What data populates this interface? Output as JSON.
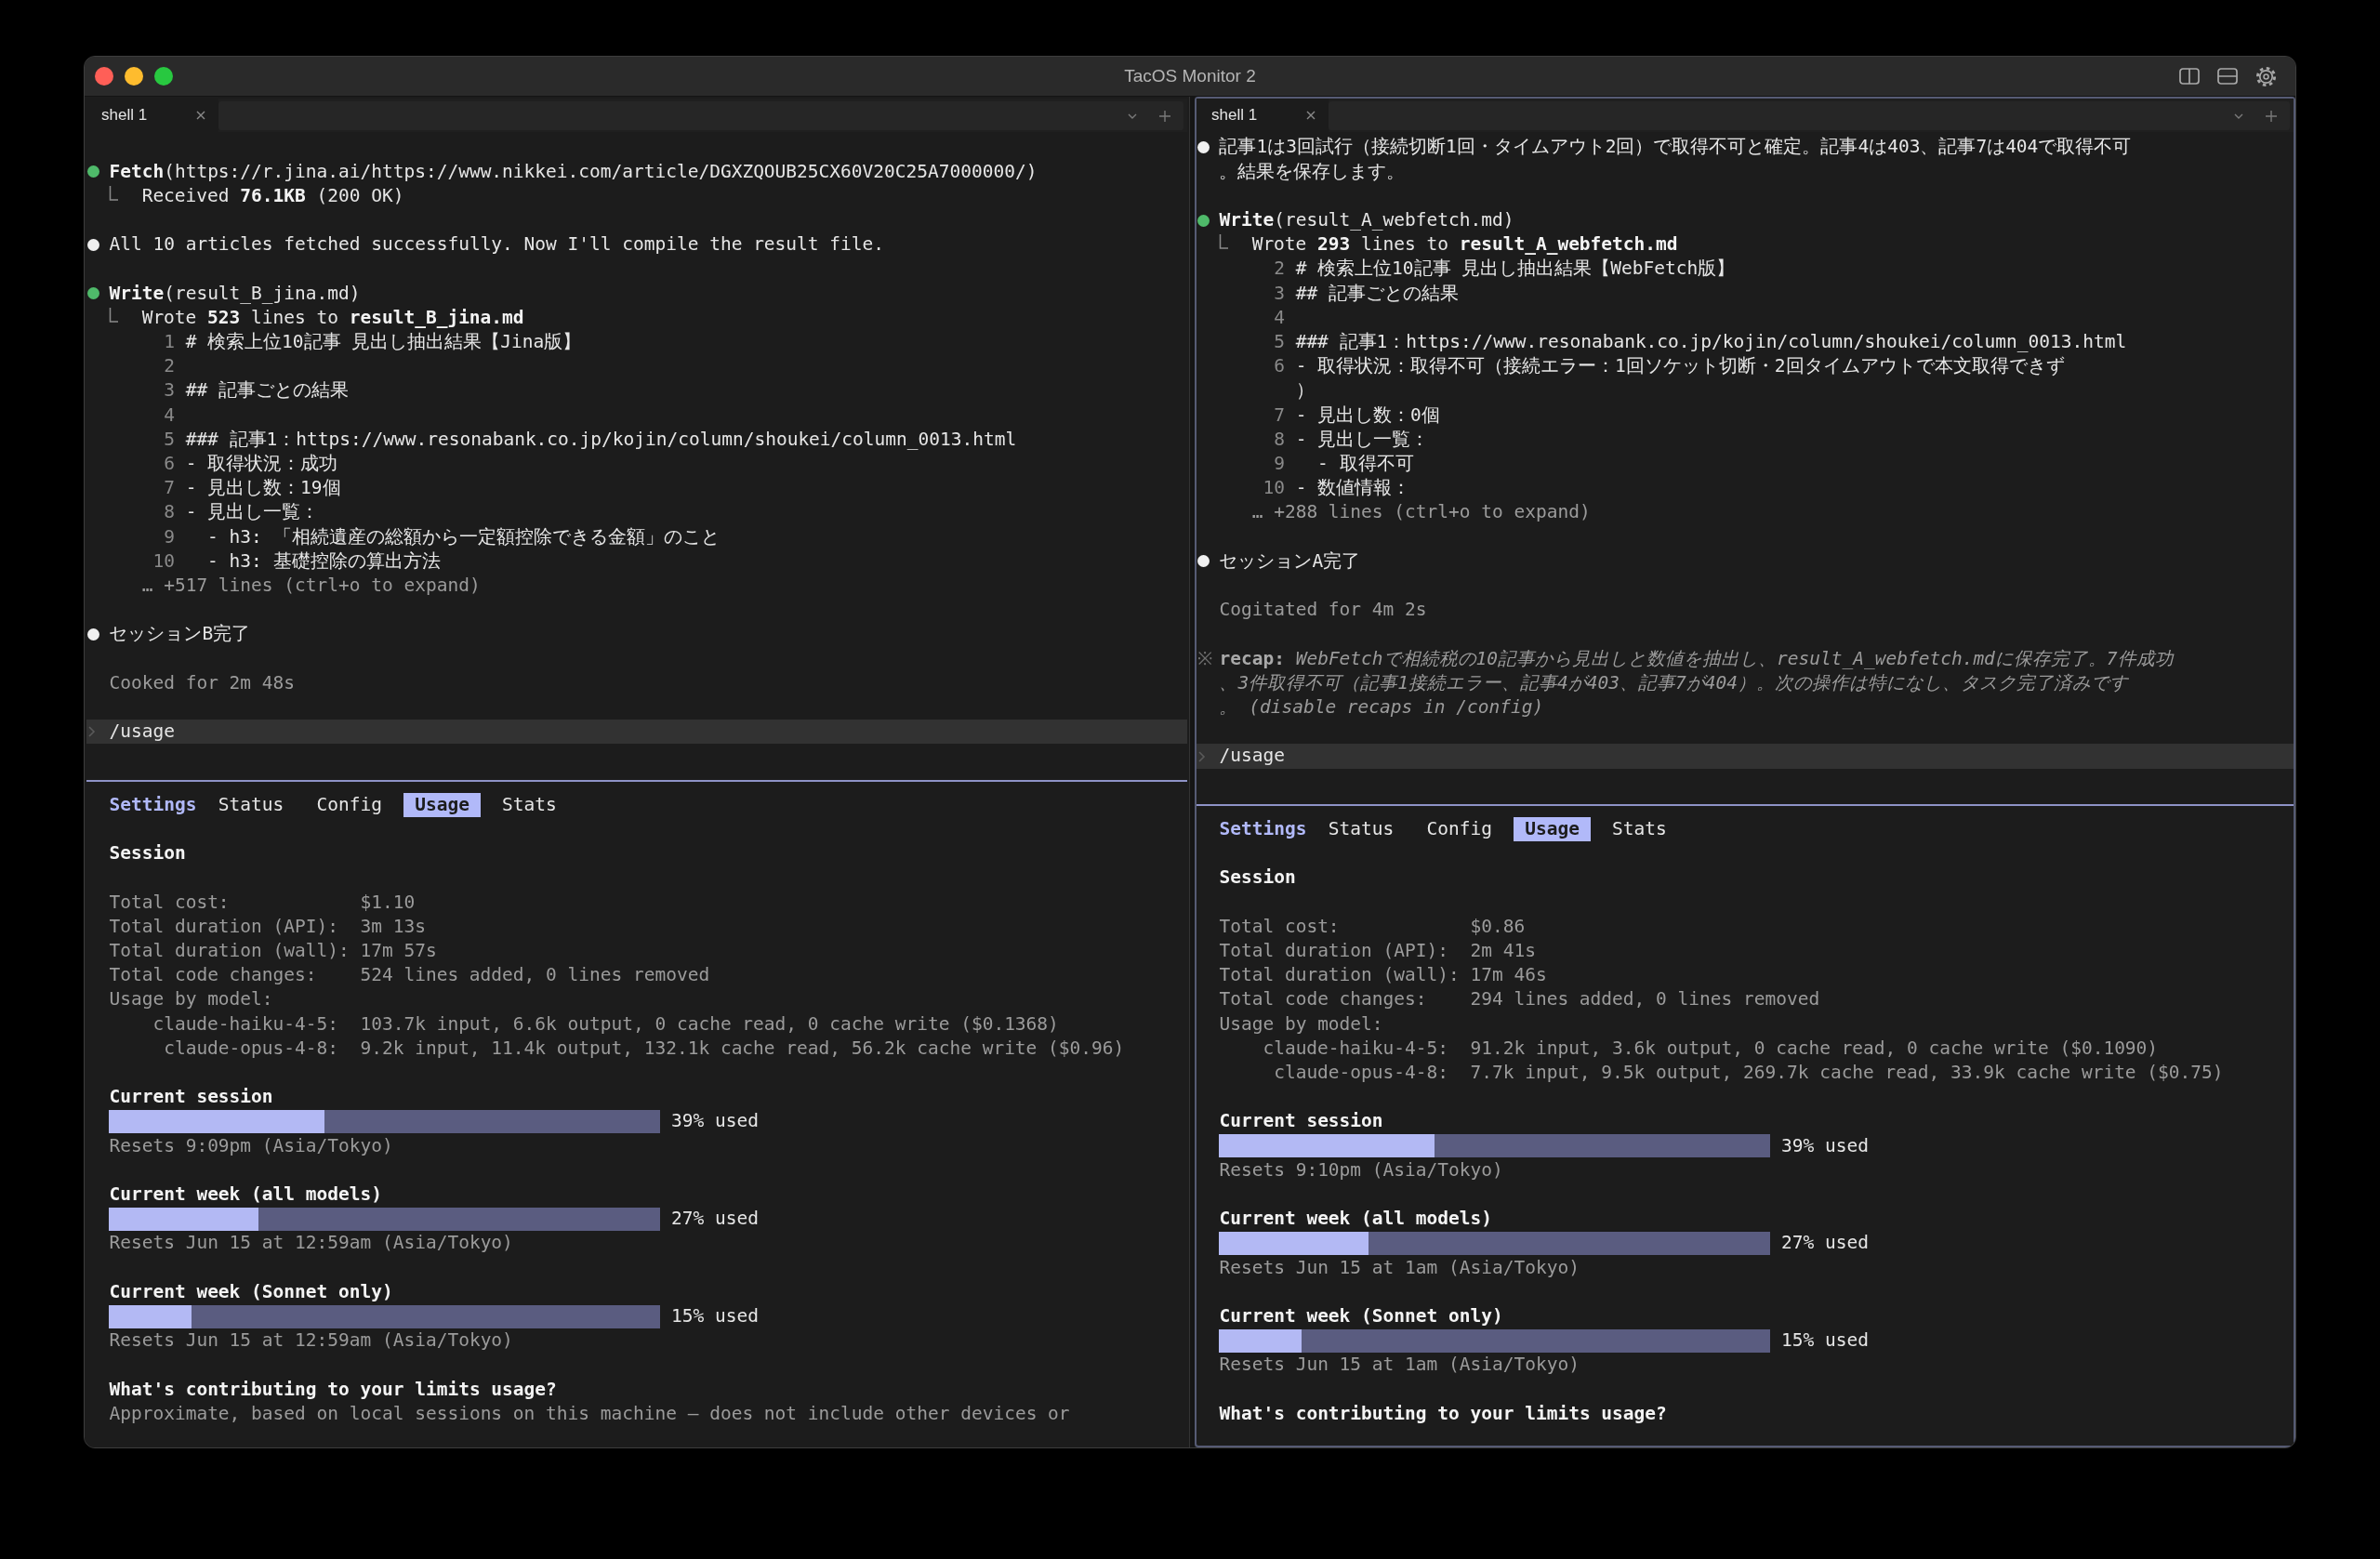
{
  "window": {
    "title": "TacOS Monitor 2"
  },
  "panes": [
    {
      "focused": false,
      "tabs": [
        {
          "label": "shell 1",
          "selected": true
        }
      ],
      "transcript": [
        {
          "kind": "tool",
          "call": "**Fetch**(https://r.jina.ai/https://www.nikkei.com/article/DGXZQOUB25CX60V20C25A7000000/)",
          "result": "Received **76.1KB** (200 OK)"
        },
        {
          "kind": "message",
          "text": "All 10 articles fetched successfully. Now I'll compile the result file."
        },
        {
          "kind": "tool",
          "call": "**Write**(result_B_jina.md)",
          "result": "Wrote **523** lines to **result_B_jina.md**",
          "preview": [
            {
              "number": "1",
              "text": "# 検索上位10記事 見出し抽出結果【Jina版】"
            },
            {
              "number": "2"
            },
            {
              "number": "3",
              "text": "## 記事ごとの結果"
            },
            {
              "number": "4"
            },
            {
              "number": "5",
              "text": "### 記事1：https://www.resonabank.co.jp/kojin/column/shoukei/column_0013.html"
            },
            {
              "number": "6",
              "text": "- 取得状況：成功"
            },
            {
              "number": "7",
              "text": "- 見出し数：19個"
            },
            {
              "number": "8",
              "text": "- 見出し一覧："
            },
            {
              "number": "9",
              "text": "  - h3: 「相続遺産の総額から一定額控除できる金額」のこと"
            },
            {
              "number": "10",
              "text": "  - h3: 基礎控除の算出方法"
            }
          ],
          "more": "… +517 lines (ctrl+o to expand)"
        },
        {
          "kind": "message",
          "text": "セッションB完了"
        },
        {
          "kind": "status",
          "text": "Cooked for 2m 48s"
        }
      ],
      "prompt": {
        "value": "/usage"
      },
      "settings": {
        "title": "Settings",
        "tabs": [
          {
            "label": "Status",
            "selected": false
          },
          {
            "label": "Config",
            "selected": false
          },
          {
            "label": "Usage",
            "selected": true
          },
          {
            "label": "Stats",
            "selected": false
          }
        ],
        "section": "Session",
        "stats": [
          {
            "label": "Total cost:",
            "value": "$1.10"
          },
          {
            "label": "Total duration (API):",
            "value": "3m 13s"
          },
          {
            "label": "Total duration (wall):",
            "value": "17m 57s"
          },
          {
            "label": "Total code changes:",
            "value": "524 lines added, 0 lines removed"
          },
          {
            "label": "Usage by model:"
          }
        ],
        "models": [
          {
            "name": "claude-haiku-4-5:",
            "value": "103.7k input, 6.6k output, 0 cache read, 0 cache write ($0.1368)"
          },
          {
            "name": "claude-opus-4-8:",
            "value": "9.2k input, 11.4k output, 132.1k cache read, 56.2k cache write ($0.96)"
          }
        ],
        "limits": [
          {
            "title": "Current session",
            "level": 0.39,
            "reading": "39% used",
            "resets": "Resets 9:09pm (Asia/Tokyo)"
          },
          {
            "title": "Current week (all models)",
            "level": 0.27,
            "reading": "27% used",
            "resets": "Resets Jun 15 at 12:59am (Asia/Tokyo)"
          },
          {
            "title": "Current week (Sonnet only)",
            "level": 0.15,
            "reading": "15% used",
            "resets": "Resets Jun 15 at 12:59am (Asia/Tokyo)"
          }
        ],
        "contributions": {
          "title": "What's contributing to your limits usage?",
          "note": "Approximate, based on local sessions on this machine — does not include other devices or"
        }
      }
    },
    {
      "focused": true,
      "tabs": [
        {
          "label": "shell 1",
          "selected": true
        }
      ],
      "transcript": [
        {
          "kind": "message",
          "text": "記事1は3回試行（接続切断1回・タイムアウト2回）で取得不可と確定。記事4は403、記事7は404で取得不可。結果を保存します。"
        },
        {
          "kind": "tool",
          "call": "**Write**(result_A_webfetch.md)",
          "result": "Wrote **293** lines to **result_A_webfetch.md**",
          "preview": [
            {
              "number": "2",
              "text": "# 検索上位10記事 見出し抽出結果【WebFetch版】"
            },
            {
              "number": "3",
              "text": "## 記事ごとの結果"
            },
            {
              "number": "4"
            },
            {
              "number": "5",
              "text": "### 記事1：https://www.resonabank.co.jp/kojin/column/shoukei/column_0013.html"
            },
            {
              "number": "6",
              "text": "- 取得状況：取得不可（接続エラー：1回ソケット切断・2回タイムアウトで本文取得できず）"
            },
            {
              "number": "7",
              "text": "- 見出し数：0個"
            },
            {
              "number": "8",
              "text": "- 見出し一覧："
            },
            {
              "number": "9",
              "text": "  - 取得不可"
            },
            {
              "number": "10",
              "text": "- 数値情報："
            }
          ],
          "more": "… +288 lines (ctrl+o to expand)"
        },
        {
          "kind": "message",
          "text": "セッションA完了"
        },
        {
          "kind": "status",
          "text": "Cogitated for 4m 2s"
        },
        {
          "kind": "recap",
          "marker": "※",
          "label": "recap:",
          "text": "WebFetchで相続税の10記事から見出しと数値を抽出し、result_A_webfetch.mdに保存完了。7件成功、3件取得不可（記事1接続エラー、記事4が403、記事7が404）。次の操作は特になし、タスク完了済みです。 (disable recaps in /config)"
        }
      ],
      "prompt": {
        "value": "/usage"
      },
      "settings": {
        "title": "Settings",
        "tabs": [
          {
            "label": "Status",
            "selected": false
          },
          {
            "label": "Config",
            "selected": false
          },
          {
            "label": "Usage",
            "selected": true
          },
          {
            "label": "Stats",
            "selected": false
          }
        ],
        "section": "Session",
        "stats": [
          {
            "label": "Total cost:",
            "value": "$0.86"
          },
          {
            "label": "Total duration (API):",
            "value": "2m 41s"
          },
          {
            "label": "Total duration (wall):",
            "value": "17m 46s"
          },
          {
            "label": "Total code changes:",
            "value": "294 lines added, 0 lines removed"
          },
          {
            "label": "Usage by model:"
          }
        ],
        "models": [
          {
            "name": "claude-haiku-4-5:",
            "value": "91.2k input, 3.6k output, 0 cache read, 0 cache write ($0.1090)"
          },
          {
            "name": "claude-opus-4-8:",
            "value": "7.7k input, 9.5k output, 269.7k cache read, 33.9k cache write ($0.75)"
          }
        ],
        "limits": [
          {
            "title": "Current session",
            "level": 0.39,
            "reading": "39% used",
            "resets": "Resets 9:10pm (Asia/Tokyo)"
          },
          {
            "title": "Current week (all models)",
            "level": 0.27,
            "reading": "27% used",
            "resets": "Resets Jun 15 at 1am (Asia/Tokyo)"
          },
          {
            "title": "Current week (Sonnet only)",
            "level": 0.15,
            "reading": "15% used",
            "resets": "Resets Jun 15 at 1am (Asia/Tokyo)"
          }
        ],
        "contributions": {
          "title": "What's contributing to your limits usage?"
        }
      }
    }
  ]
}
